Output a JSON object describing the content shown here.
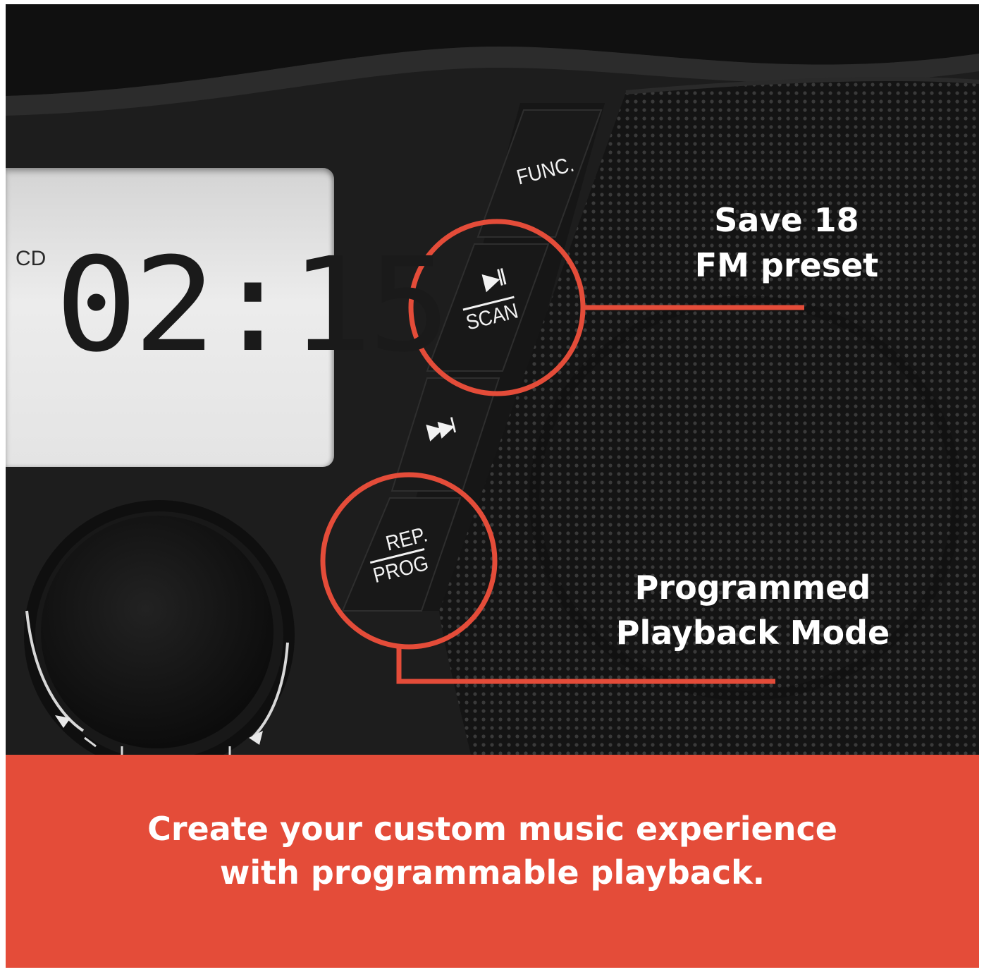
{
  "display": {
    "source": "CD",
    "time": "02:15"
  },
  "buttons": {
    "func_label": "FUNC.",
    "play_pause_icon": "▶II",
    "scan_label": "SCAN",
    "skip_icon": "▶▶I",
    "rep_label": "REP.",
    "prog_label": "PROG"
  },
  "callouts": {
    "top_line1": "Save 18",
    "top_line2": "FM preset",
    "bottom_line1": "Programmed",
    "bottom_line2": "Playback Mode"
  },
  "banner": {
    "line1": "Create your custom music experience",
    "line2": "with programmable playback."
  },
  "colors": {
    "accent": "#e44c39",
    "body": "#1e1e1e"
  },
  "icons": {
    "play_pause": "play-pause-icon",
    "skip_next": "skip-next-icon"
  }
}
